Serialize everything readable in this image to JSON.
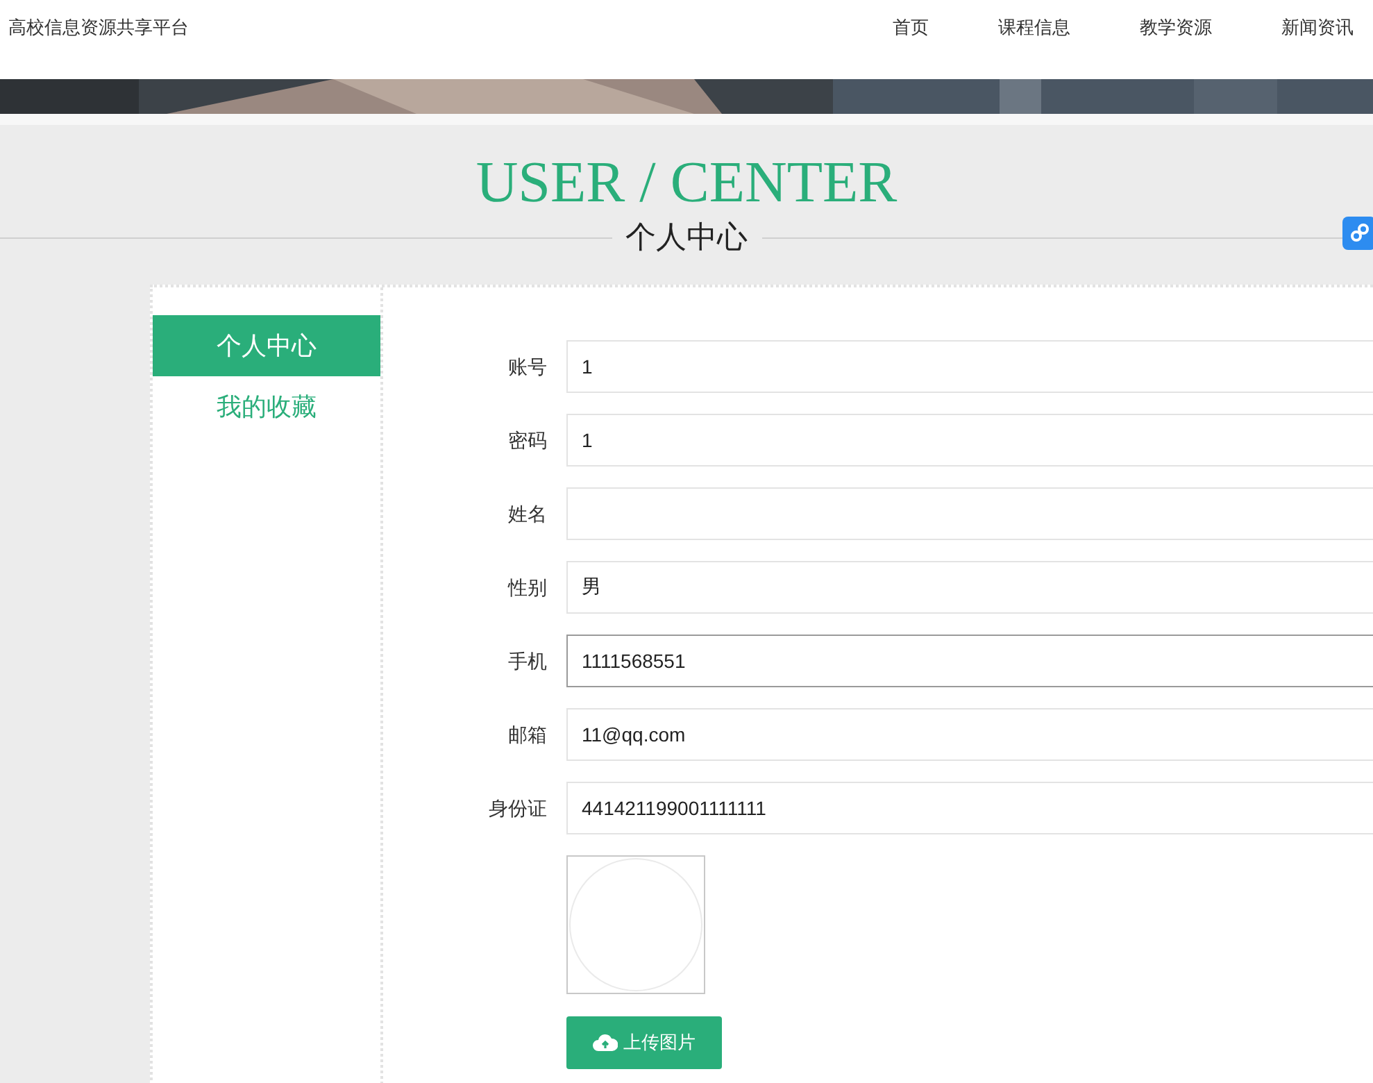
{
  "site_title": "高校信息资源共享平台",
  "nav": [
    {
      "label": "首页"
    },
    {
      "label": "课程信息"
    },
    {
      "label": "教学资源"
    },
    {
      "label": "新闻资讯"
    }
  ],
  "heading": {
    "title": "USER / CENTER",
    "subtitle": "个人中心"
  },
  "sidebar": {
    "items": [
      {
        "label": "个人中心",
        "selected": true
      },
      {
        "label": "我的收藏",
        "selected": false
      }
    ]
  },
  "form": {
    "fields": [
      {
        "label": "账号",
        "value": "1",
        "focused": false
      },
      {
        "label": "密码",
        "value": "1",
        "focused": false
      },
      {
        "label": "姓名",
        "focused": false
      },
      {
        "label": "性别",
        "value": "男",
        "focused": false
      },
      {
        "label": "手机",
        "value": "1111568551",
        "focused": true
      },
      {
        "label": "邮箱",
        "value": "11@qq.com",
        "focused": false
      },
      {
        "label": "身份证",
        "value": "441421199001111111",
        "focused": false
      }
    ],
    "upload_button": "上传图片"
  }
}
